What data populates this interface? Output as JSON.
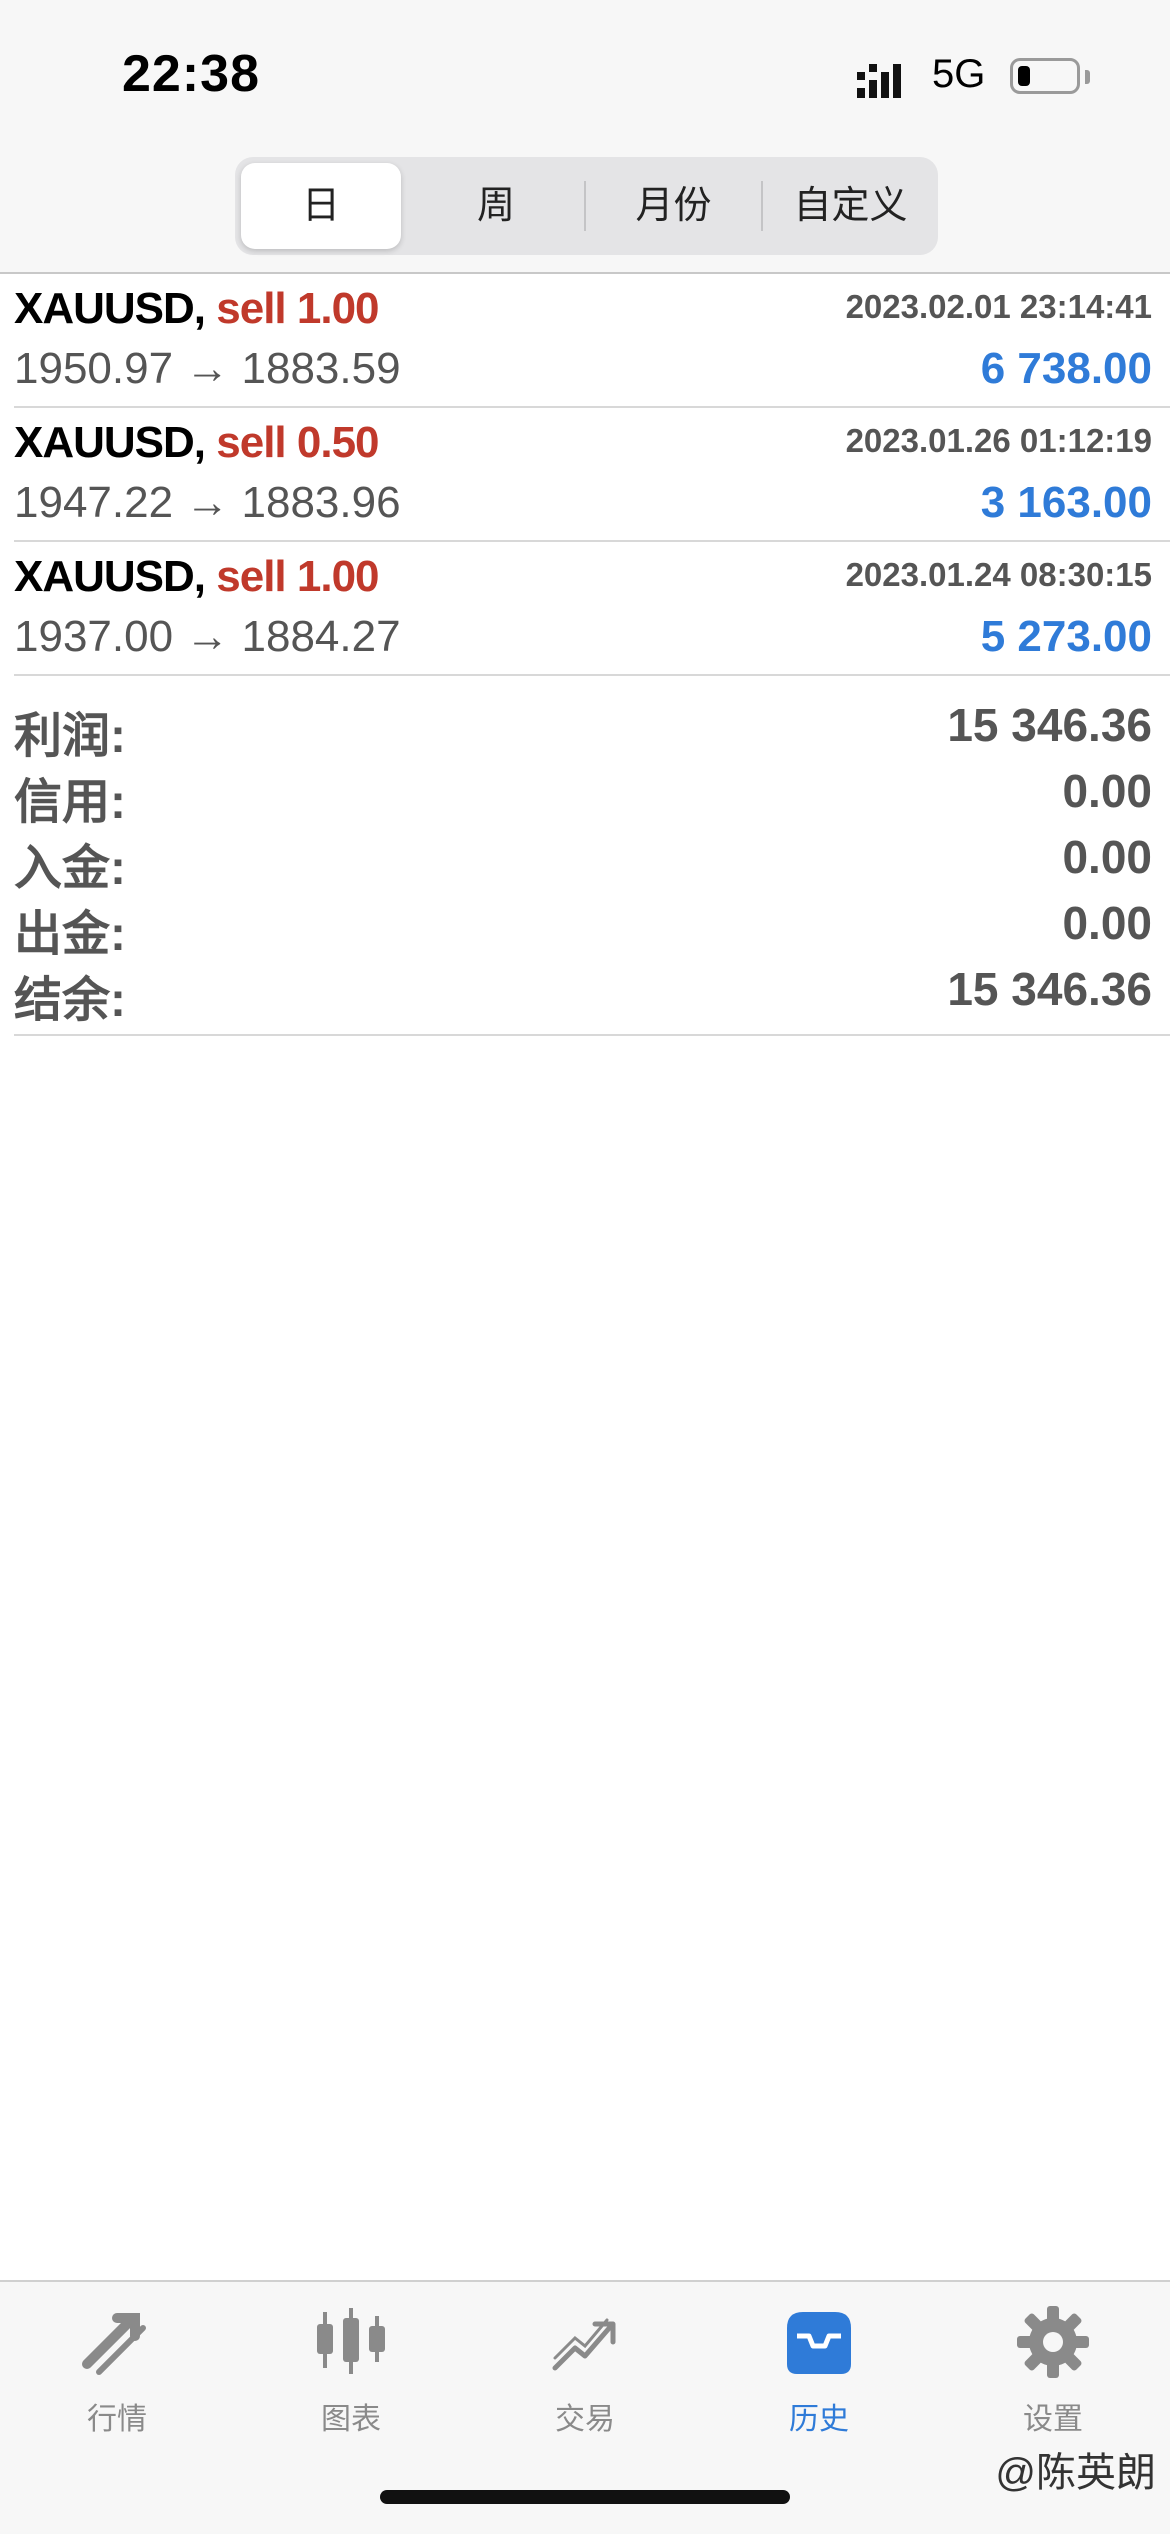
{
  "status": {
    "time": "22:38",
    "network": "5G"
  },
  "period_tabs": [
    {
      "label": "日",
      "active": true
    },
    {
      "label": "周",
      "active": false
    },
    {
      "label": "月份",
      "active": false
    },
    {
      "label": "自定义",
      "active": false
    }
  ],
  "trades": [
    {
      "symbol": "XAUUSD,",
      "side": "sell 1.00",
      "time": "2023.02.01 23:14:41",
      "prices": "1950.97 → 1883.59",
      "profit": "6 738.00"
    },
    {
      "symbol": "XAUUSD,",
      "side": "sell 0.50",
      "time": "2023.01.26 01:12:19",
      "prices": "1947.22 → 1883.96",
      "profit": "3 163.00"
    },
    {
      "symbol": "XAUUSD,",
      "side": "sell 1.00",
      "time": "2023.01.24 08:30:15",
      "prices": "1937.00 → 1884.27",
      "profit": "5 273.00"
    }
  ],
  "summary": [
    {
      "label": "利润:",
      "value": "15 346.36"
    },
    {
      "label": "信用:",
      "value": "0.00"
    },
    {
      "label": "入金:",
      "value": "0.00"
    },
    {
      "label": "出金:",
      "value": "0.00"
    },
    {
      "label": "结余:",
      "value": "15 346.36"
    }
  ],
  "tabbar": [
    {
      "label": "行情",
      "icon": "quotes-icon",
      "active": false
    },
    {
      "label": "图表",
      "icon": "chart-icon",
      "active": false
    },
    {
      "label": "交易",
      "icon": "trade-icon",
      "active": false
    },
    {
      "label": "历史",
      "icon": "history-icon",
      "active": true
    },
    {
      "label": "设置",
      "icon": "settings-icon",
      "active": false
    }
  ],
  "watermark": "@陈英朗",
  "colors": {
    "accent": "#2f7bd8",
    "sell": "#c0392b",
    "inactive_tab": "#8a8a8a"
  }
}
